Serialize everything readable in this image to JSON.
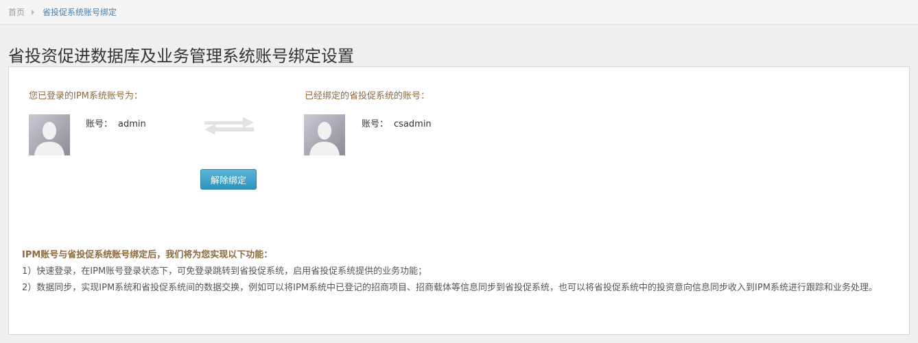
{
  "breadcrumb": {
    "home": "首页",
    "current": "省投促系统账号绑定"
  },
  "page": {
    "title": "省投资促进数据库及业务管理系统账号绑定设置"
  },
  "binding": {
    "left": {
      "label": "您已登录的IPM系统账号为：",
      "account_key": "账号：",
      "account_value": "admin"
    },
    "right": {
      "label": "已经绑定的省投促系统的账号：",
      "account_key": "账号：",
      "account_value": "csadmin"
    },
    "swap_icon": "exchange-arrows-icon",
    "unbind_label": "解除绑定"
  },
  "notes": {
    "title": "IPM账号与省投促系统账号绑定后，我们将为您实现以下功能：",
    "items": [
      "1）快速登录，在IPM账号登录状态下，可免登录跳转到省投促系统，启用省投促系统提供的业务功能；",
      "2）数据同步，实现IPM系统和省投促系统间的数据交换，例如可以将IPM系统中已登记的招商项目、招商载体等信息同步到省投促系统，也可以将省投促系统中的投资意向信息同步收入到IPM系统进行跟踪和业务处理。"
    ]
  },
  "colors": {
    "accent_label": "#8b6a3e",
    "button": "#2f93bd",
    "link": "#4a7ea8"
  }
}
